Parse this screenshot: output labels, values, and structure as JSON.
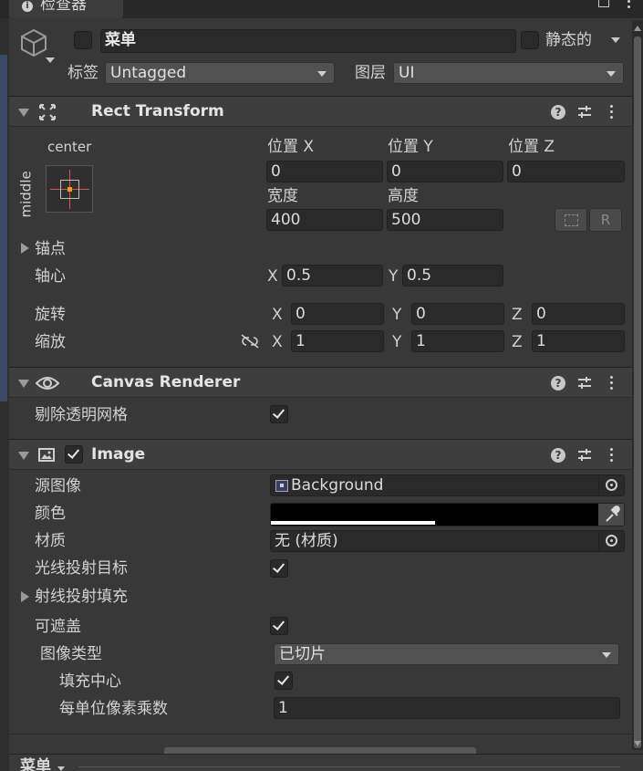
{
  "window": {
    "title": "检查器"
  },
  "object": {
    "name": "菜单",
    "static_label": "静态的",
    "tag_label": "标签",
    "tag_value": "Untagged",
    "layer_label": "图层",
    "layer_value": "UI"
  },
  "rect_transform": {
    "title": "Rect Transform",
    "anchor_h": "center",
    "anchor_v": "middle",
    "pos_x_label": "位置 X",
    "pos_y_label": "位置 Y",
    "pos_z_label": "位置 Z",
    "pos_x": "0",
    "pos_y": "0",
    "pos_z": "0",
    "width_label": "宽度",
    "height_label": "高度",
    "width": "400",
    "height": "500",
    "raw_edit_label": "R",
    "anchors_label": "锚点",
    "pivot_label": "轴心",
    "pivot_x": "0.5",
    "pivot_y": "0.5",
    "rotation_label": "旋转",
    "rot_x": "0",
    "rot_y": "0",
    "rot_z": "0",
    "scale_label": "缩放",
    "scale_x": "1",
    "scale_y": "1",
    "scale_z": "1",
    "x": "X",
    "y": "Y",
    "z": "Z"
  },
  "canvas_renderer": {
    "title": "Canvas Renderer",
    "cull_label": "剔除透明网格",
    "cull": true
  },
  "image": {
    "title": "Image",
    "enabled": true,
    "source_label": "源图像",
    "source_value": "Background",
    "color_label": "颜色",
    "color_value": "#000000",
    "color_alpha": 0.5,
    "material_label": "材质",
    "material_value": "无 (材质)",
    "raycast_label": "光线投射目标",
    "raycast": true,
    "raycast_padding_label": "射线投射填充",
    "maskable_label": "可遮盖",
    "maskable": true,
    "image_type_label": "图像类型",
    "image_type_value": "已切片",
    "fill_center_label": "填充中心",
    "fill_center": true,
    "ppu_label": "每单位像素乘数",
    "ppu_value": "1"
  },
  "footer": {
    "preview_label": "菜单"
  },
  "colors": {
    "background": "#383838",
    "header": "#3e3e3e",
    "field": "#2a2a2a",
    "accent_orange": "#f0a020",
    "anchor_red": "#e05050"
  }
}
